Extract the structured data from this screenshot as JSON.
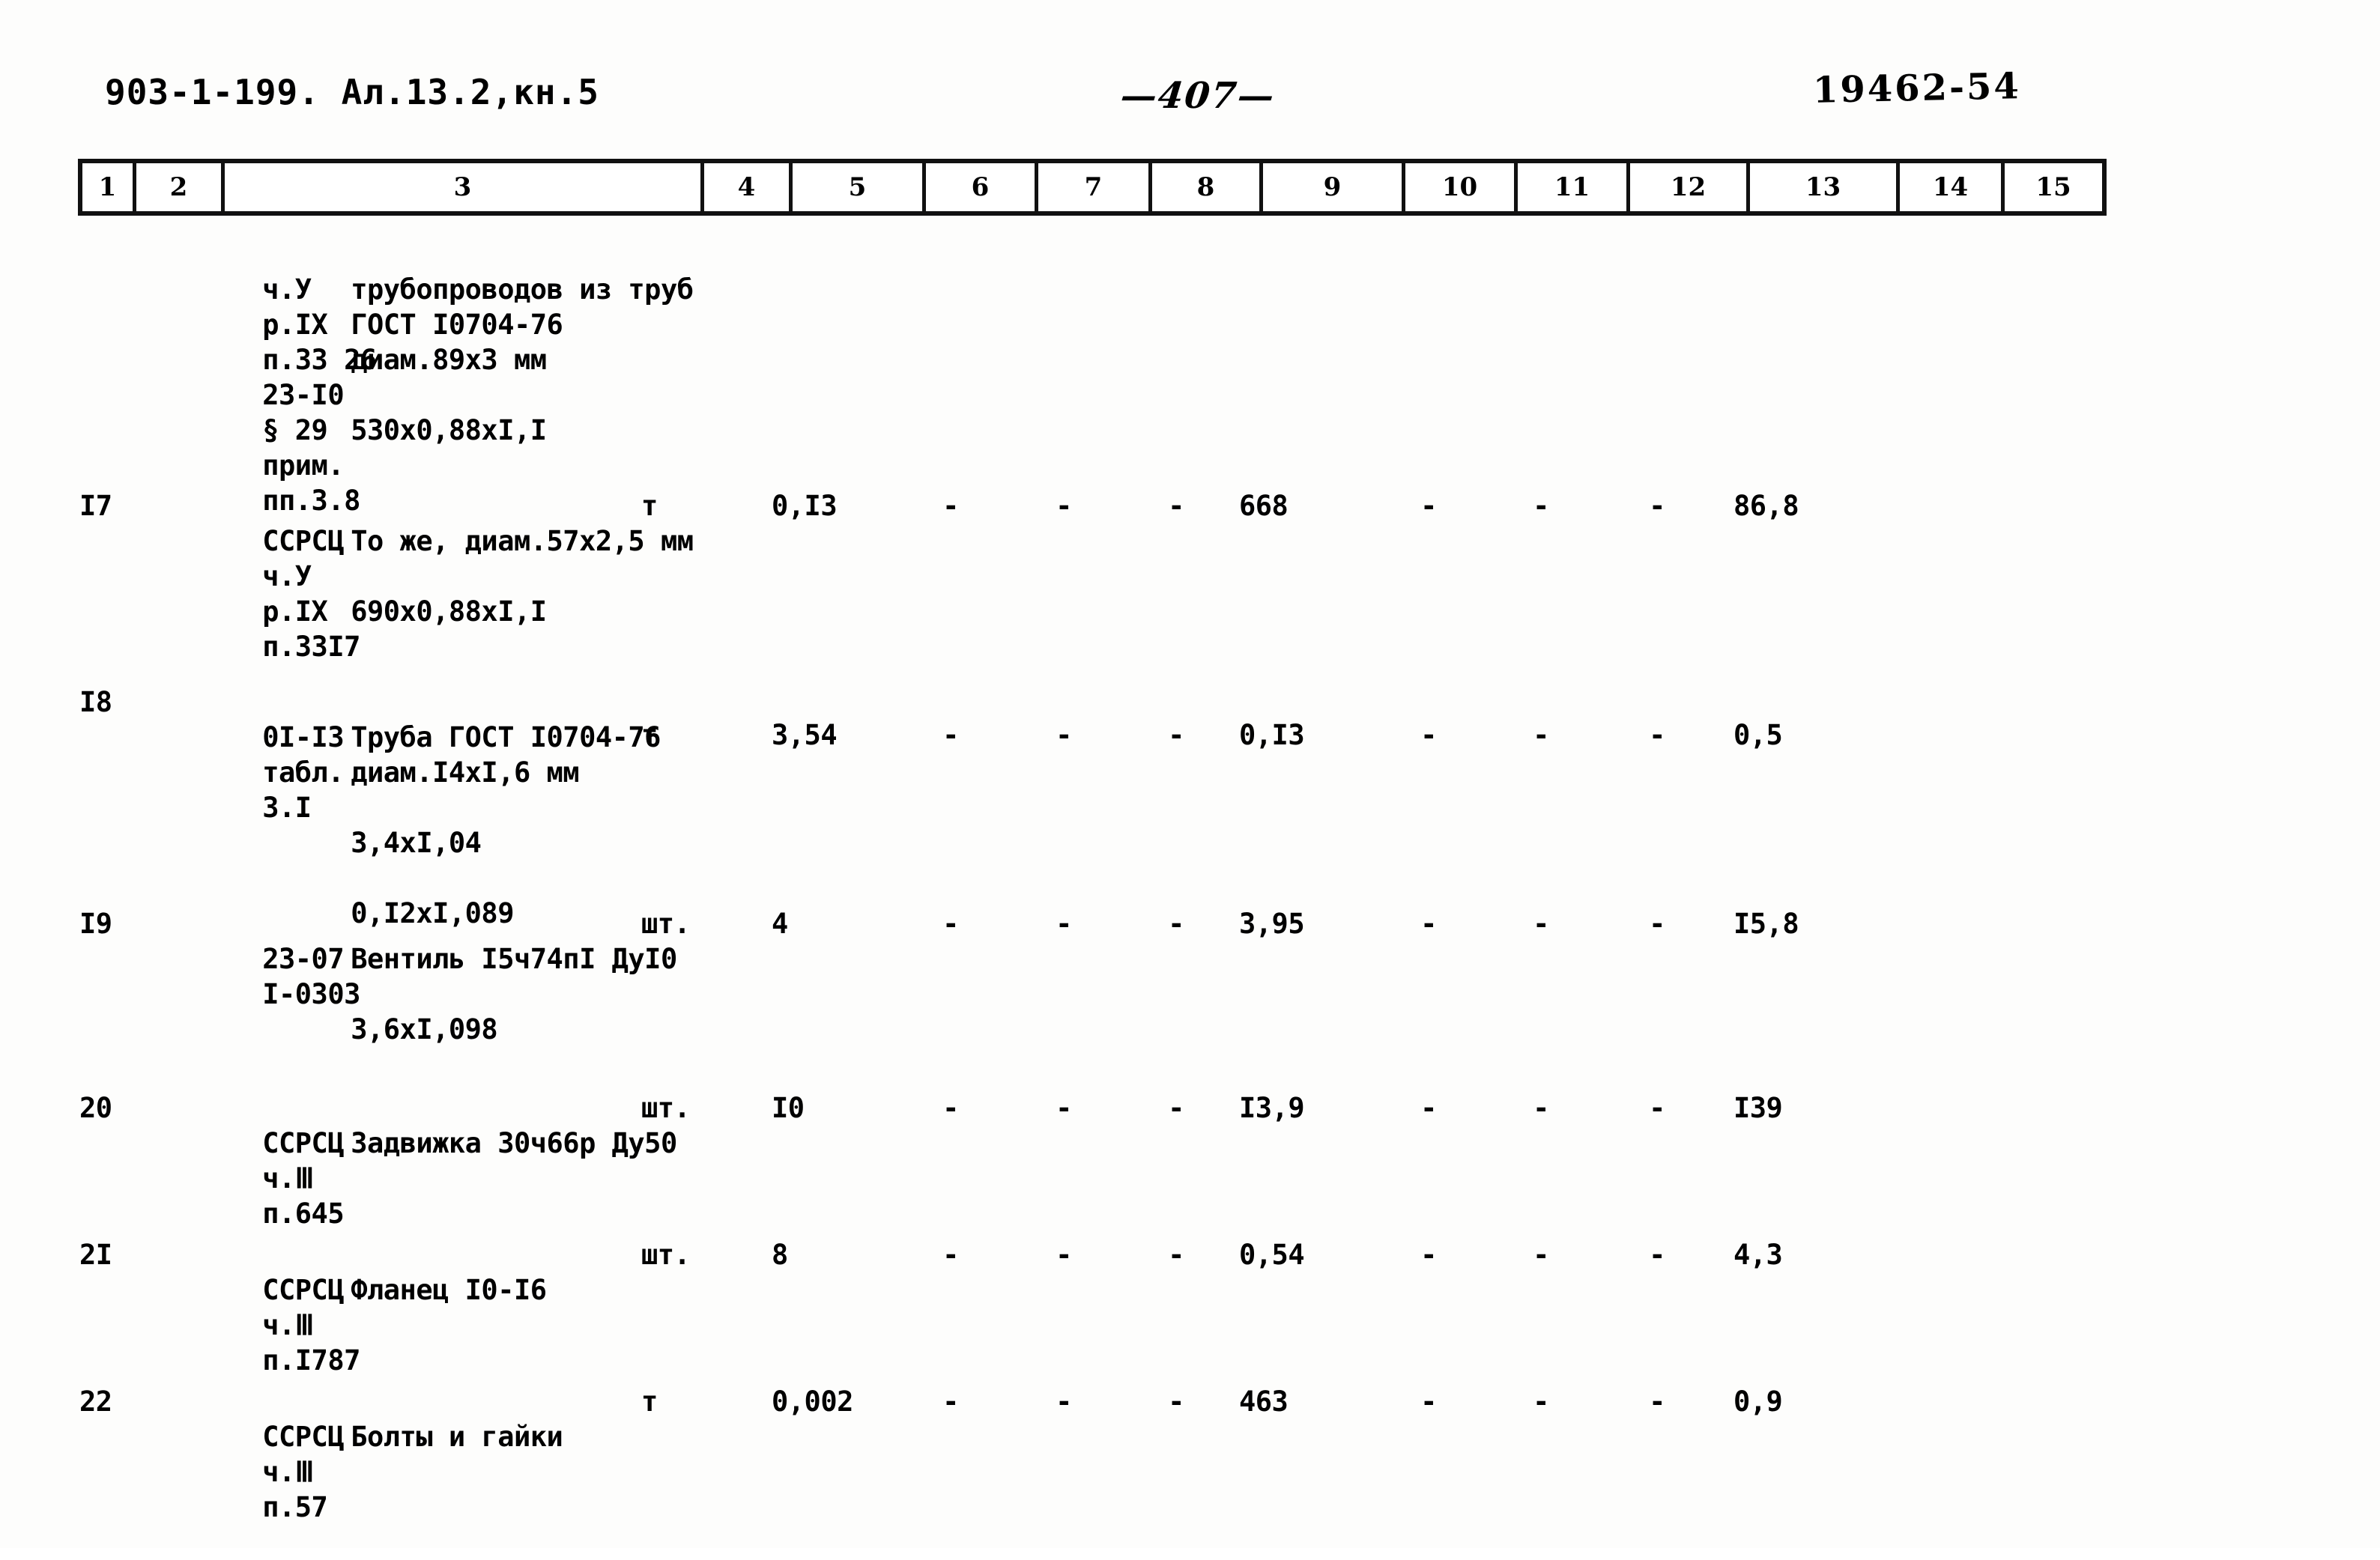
{
  "header": {
    "doc_code": "903-1-199. Ал.13.2,кн.5",
    "page_number": "—407—",
    "stamp_number": "19462-54"
  },
  "column_headers": [
    "1",
    "2",
    "3",
    "4",
    "5",
    "6",
    "7",
    "8",
    "9",
    "10",
    "11",
    "12",
    "13",
    "14",
    "15"
  ],
  "rows": [
    {
      "num": "",
      "justification": [
        "ч.У",
        "р.IX",
        "п.33 26",
        "23-I0",
        "§ 29",
        "прим.",
        "пп.3.8"
      ],
      "name": [
        "трубопроводов из труб",
        "ГОСТ I0704-76",
        "диам.89х3 мм",
        "",
        "530х0,88хI,I"
      ],
      "unit": "",
      "c5": "",
      "c6": "",
      "c7": "",
      "c8": "",
      "c9": "",
      "c10": "",
      "c11": "",
      "c12": "",
      "c13": "",
      "c14": "",
      "c15": ""
    },
    {
      "num": "I7",
      "justification": [
        "ССРСЦ",
        "ч.У",
        "р.IX",
        "п.33I7"
      ],
      "name": [
        "То же, диам.57х2,5 мм",
        "",
        "690х0,88хI,I"
      ],
      "unit": "т",
      "c5": "0,I3",
      "c6": "-",
      "c7": "-",
      "c8": "-",
      "c9": "668",
      "c10": "-",
      "c11": "-",
      "c12": "-",
      "c13": "86,8",
      "c14": "",
      "c15": ""
    },
    {
      "num": "I8",
      "justification": [
        "0I-I3",
        "табл.",
        "3.I"
      ],
      "name": [
        "Труба ГОСТ I0704-76",
        "диам.I4хI,6 мм",
        "",
        "3,4хI,04",
        "",
        "0,I2хI,089"
      ],
      "unit": "т",
      "c5": "3,54",
      "c6": "-",
      "c7": "-",
      "c8": "-",
      "c9": "0,I3",
      "c10": "-",
      "c11": "-",
      "c12": "-",
      "c13": "0,5",
      "c14": "",
      "c15": ""
    },
    {
      "num": "I9",
      "justification": [
        "23-07",
        "I-0303"
      ],
      "name": [
        "Вентиль I5ч74пI ДуI0",
        "",
        "3,6хI,098"
      ],
      "unit": "шт.",
      "c5": "4",
      "c6": "-",
      "c7": "-",
      "c8": "-",
      "c9": "3,95",
      "c10": "-",
      "c11": "-",
      "c12": "-",
      "c13": "I5,8",
      "c14": "",
      "c15": ""
    },
    {
      "num": "20",
      "justification": [
        "ССРСЦ",
        "ч.Ⅲ",
        "п.645"
      ],
      "name": [
        "Задвижка 30ч66р Ду50"
      ],
      "unit": "шт.",
      "c5": "I0",
      "c6": "-",
      "c7": "-",
      "c8": "-",
      "c9": "I3,9",
      "c10": "-",
      "c11": "-",
      "c12": "-",
      "c13": "I39",
      "c14": "",
      "c15": ""
    },
    {
      "num": "2I",
      "justification": [
        "ССРСЦ",
        "ч.Ⅲ",
        "п.I787"
      ],
      "name": [
        "Фланец I0-I6"
      ],
      "unit": "шт.",
      "c5": "8",
      "c6": "-",
      "c7": "-",
      "c8": "-",
      "c9": "0,54",
      "c10": "-",
      "c11": "-",
      "c12": "-",
      "c13": "4,3",
      "c14": "",
      "c15": ""
    },
    {
      "num": "22",
      "justification": [
        "ССРСЦ",
        "ч.Ⅲ",
        "п.57"
      ],
      "name": [
        "Болты и гайки"
      ],
      "unit": "т",
      "c5": "0,002",
      "c6": "-",
      "c7": "-",
      "c8": "-",
      "c9": "463",
      "c10": "-",
      "c11": "-",
      "c12": "-",
      "c13": "0,9",
      "c14": "",
      "c15": ""
    }
  ]
}
